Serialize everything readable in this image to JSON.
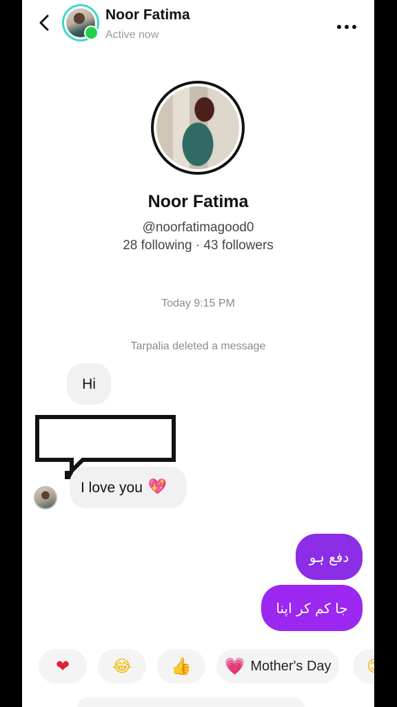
{
  "header": {
    "name": "Noor Fatima",
    "status": "Active now"
  },
  "profile": {
    "name": "Noor Fatima",
    "handle": "@noorfatimagood0",
    "follow_stats": "28 following · 43 followers"
  },
  "conversation": {
    "timestamp": "Today 9:15 PM",
    "system_message": "Tarpalia deleted a message",
    "received": [
      {
        "text": "Hi"
      },
      {
        "text": "I love you",
        "emoji": "💖"
      }
    ],
    "sent": [
      {
        "text": "دفع ہو"
      },
      {
        "text": "جا کم کر اپنا"
      }
    ]
  },
  "quick_reactions": [
    {
      "emoji": "❤",
      "icon": "heart-icon"
    },
    {
      "emoji": "😂",
      "icon": "laughing-face-icon"
    },
    {
      "emoji": "👍",
      "icon": "thumbs-up-icon"
    },
    {
      "emoji": "💗",
      "icon": "heart-icon",
      "label": "Mother's Day"
    },
    {
      "emoji": "😊",
      "icon": "smile-icon"
    }
  ],
  "colors": {
    "online": "#22d14a",
    "avatar_ring": "#3ed6d0",
    "sent_bubble": "#8b2ee6"
  }
}
